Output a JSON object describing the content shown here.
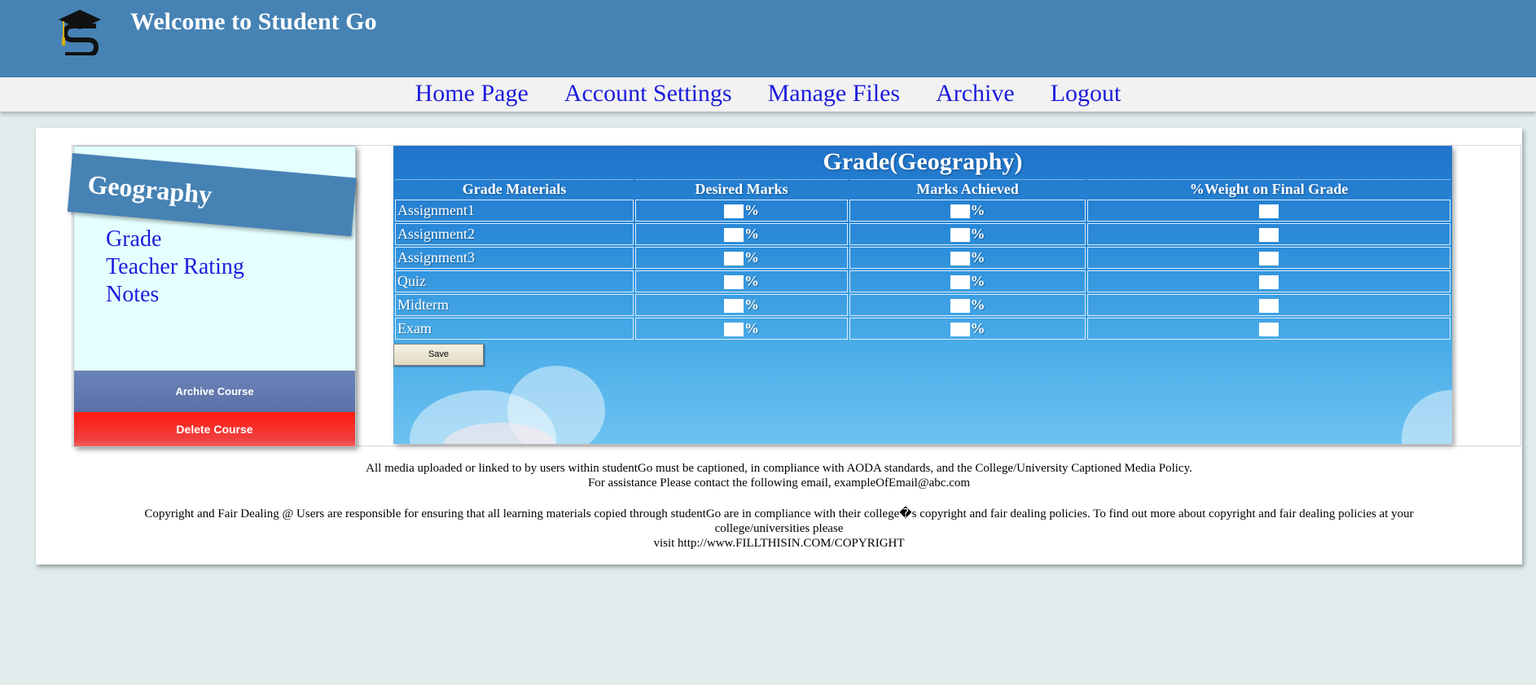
{
  "header": {
    "title": "Welcome to Student Go"
  },
  "nav": {
    "items": [
      "Home Page",
      "Account Settings",
      "Manage Files",
      "Archive",
      "Logout"
    ]
  },
  "sidebar": {
    "course_title": "Geography",
    "links": [
      "Grade",
      "Teacher Rating",
      "Notes"
    ],
    "archive_label": "Archive Course",
    "delete_label": "Delete Course"
  },
  "grades": {
    "heading": "Grade(Geography)",
    "columns": [
      "Grade Materials",
      "Desired Marks",
      "Marks Achieved",
      "%Weight on Final Grade"
    ],
    "percent_symbol": "%",
    "rows": [
      "Assignment1",
      "Assignment2",
      "Assignment3",
      "Quiz",
      "Midterm",
      "Exam"
    ],
    "save_label": "Save"
  },
  "footer": {
    "line1": "All media uploaded or linked to by users within studentGo must be captioned, in compliance with AODA standards, and the College/University Captioned Media Policy.",
    "line2": "For assistance Please contact the following email, exampleOfEmail@abc.com",
    "copyright": "Copyright and Fair Dealing @ Users are responsible for ensuring that all learning materials copied through studentGo are in compliance with their college�s copyright and fair dealing policies. To find out more about copyright and fair dealing policies at your college/universities please",
    "visit": "visit http://www.FILLTHISIN.COM/COPYRIGHT"
  },
  "colors": {
    "header_bg": "#4682b4",
    "nav_link": "#1c1cdc",
    "delete_red": "#ff1a0d",
    "archive_blue": "#6b84b8",
    "page_bg": "#e0ecec"
  }
}
